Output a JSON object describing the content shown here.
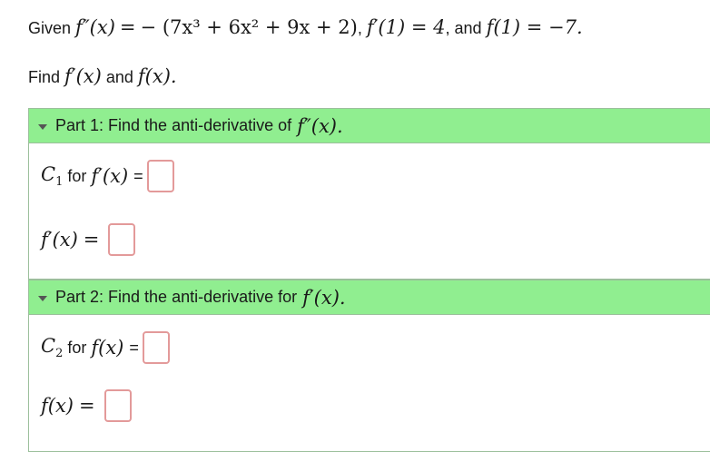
{
  "problem": {
    "given": "Given",
    "f_second": "f″(x)",
    "equals": "=",
    "expression": "− (7x³ + 6x² + 9x + 2)",
    "fp_cond": "f′(1) = 4",
    "and": "and",
    "f_cond": "f(1) = −7."
  },
  "find": {
    "label": "Find",
    "fp": "f′(x)",
    "and": "and",
    "f": "f(x)."
  },
  "parts": [
    {
      "title": "Part 1: Find the anti-derivative of",
      "title_math": "f″(x).",
      "rows": [
        {
          "math": "C",
          "sub": "1",
          "label": " for ",
          "fn": "f′(x)",
          "eq": "=",
          "value": ""
        },
        {
          "math": "f′(x)",
          "eq": "=",
          "value": ""
        }
      ]
    },
    {
      "title": "Part 2: Find the anti-derivative for",
      "title_math": "f′(x).",
      "rows": [
        {
          "math": "C",
          "sub": "2",
          "label": " for ",
          "fn": "f(x)",
          "eq": "=",
          "value": ""
        },
        {
          "math": "f(x)",
          "eq": "=",
          "value": ""
        }
      ]
    }
  ],
  "colors": {
    "header_bg": "#90ee90",
    "box_border": "#e39a9a"
  }
}
